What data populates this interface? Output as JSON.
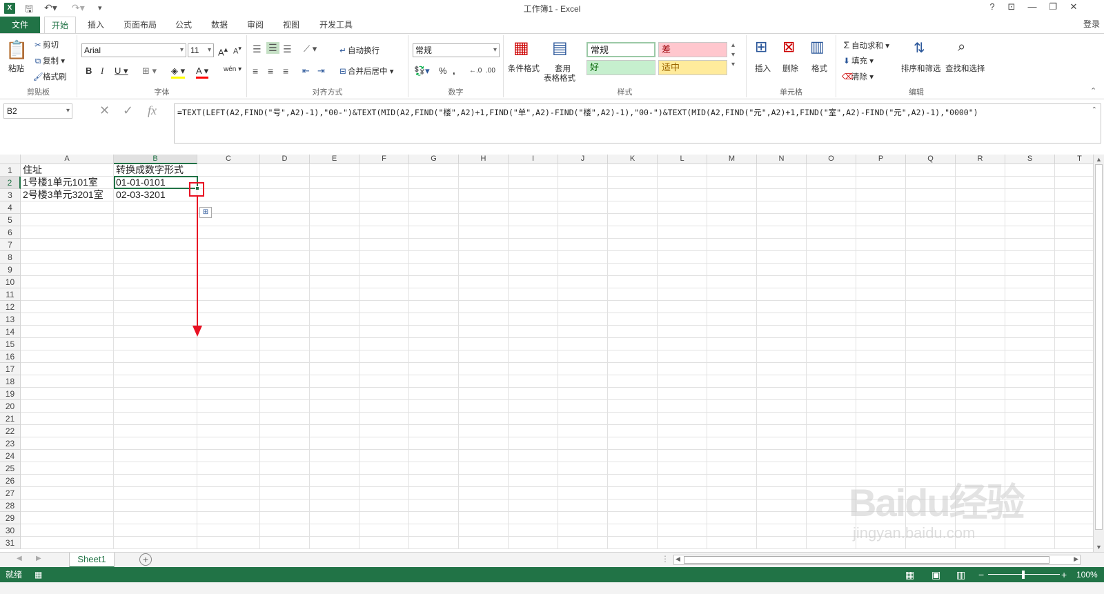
{
  "titlebar": {
    "title": "工作簿1 - Excel",
    "help": "?",
    "minimize": "—",
    "restore": "❐",
    "close": "✕",
    "app_letter": "X"
  },
  "ribbon_tabs": [
    {
      "label": "文件"
    },
    {
      "label": "开始"
    },
    {
      "label": "插入"
    },
    {
      "label": "页面布局"
    },
    {
      "label": "公式"
    },
    {
      "label": "数据"
    },
    {
      "label": "审阅"
    },
    {
      "label": "视图"
    },
    {
      "label": "开发工具"
    }
  ],
  "login": "登录",
  "groups": {
    "clipboard": {
      "label": "剪贴板",
      "paste": "粘贴",
      "cut": "剪切",
      "copy": "复制",
      "format_painter": "格式刷"
    },
    "font": {
      "label": "字体",
      "font_name": "Arial",
      "font_size": "11"
    },
    "alignment": {
      "label": "对齐方式",
      "wrap_text": "自动换行",
      "merge_center": "合并后居中"
    },
    "number": {
      "label": "数字",
      "format": "常规"
    },
    "styles": {
      "label": "样式",
      "conditional": "条件格式",
      "table_format_1": "套用",
      "table_format_2": "表格格式",
      "normal": "常规",
      "bad": "差",
      "good": "好",
      "neutral": "适中"
    },
    "cells": {
      "label": "单元格",
      "insert": "插入",
      "delete": "删除",
      "format": "格式"
    },
    "editing": {
      "label": "编辑",
      "autosum": "自动求和",
      "fill": "填充",
      "clear": "清除",
      "sort_filter": "排序和筛选",
      "find_select": "查找和选择"
    }
  },
  "formula_bar": {
    "name_box": "B2",
    "formula": "=TEXT(LEFT(A2,FIND(\"号\",A2)-1),\"00-\")&TEXT(MID(A2,FIND(\"楼\",A2)+1,FIND(\"单\",A2)-FIND(\"楼\",A2)-1),\"00-\")&TEXT(MID(A2,FIND(\"元\",A2)+1,FIND(\"室\",A2)-FIND(\"元\",A2)-1),\"0000\")"
  },
  "columns": [
    "A",
    "B",
    "C",
    "D",
    "E",
    "F",
    "G",
    "H",
    "I",
    "J",
    "K",
    "L",
    "M",
    "N",
    "O",
    "P",
    "Q",
    "R",
    "S",
    "T"
  ],
  "rows": [
    "1",
    "2",
    "3",
    "4",
    "5",
    "6",
    "7",
    "8",
    "9",
    "10",
    "11",
    "12",
    "13",
    "14",
    "15",
    "16",
    "17",
    "18",
    "19",
    "20",
    "21",
    "22",
    "23",
    "24",
    "25",
    "26",
    "27",
    "28",
    "29",
    "30",
    "31"
  ],
  "cells": {
    "A1": "住址",
    "B1": "转换成数字形式",
    "A2": "1号楼1单元101室",
    "B2": "01-01-0101",
    "A3": "2号楼3单元3201室",
    "B3": "02-03-3201"
  },
  "sheet_tabs": [
    {
      "label": "Sheet1"
    }
  ],
  "status": {
    "ready": "就绪",
    "zoom": "100%"
  },
  "watermark": {
    "line1": "Baidu经验",
    "line2": "jingyan.baidu.com"
  },
  "colors": {
    "accent": "#217346",
    "annotation": "#e81123"
  }
}
